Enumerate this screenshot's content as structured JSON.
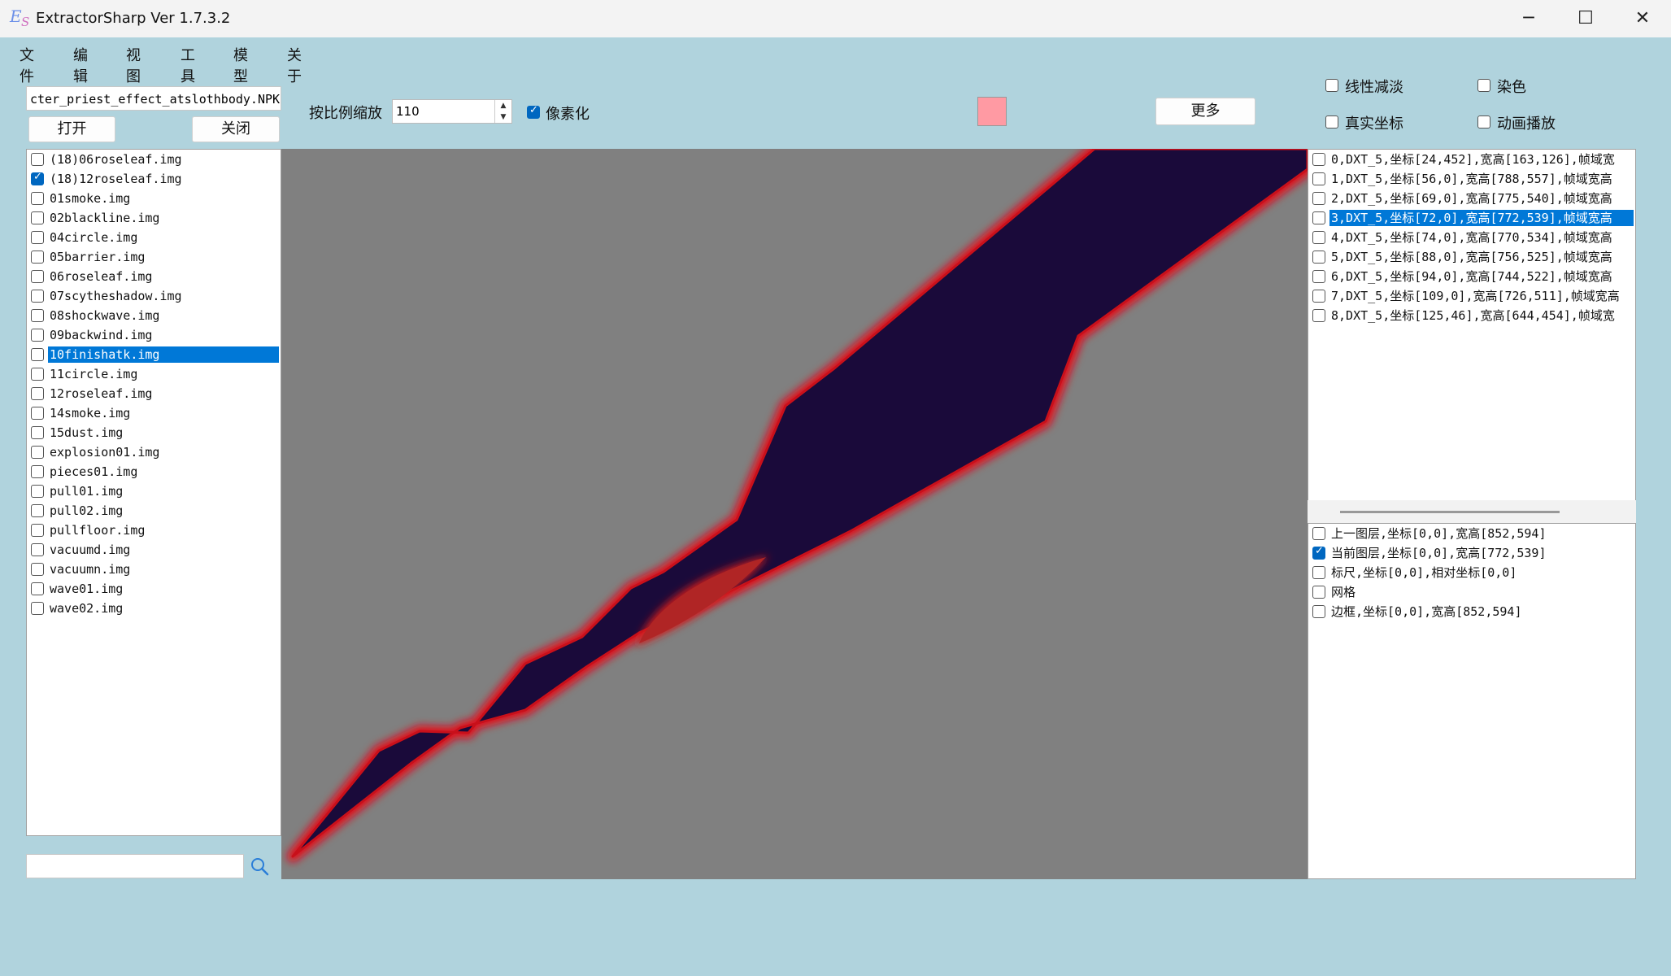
{
  "window": {
    "title": "ExtractorSharp Ver 1.7.3.2",
    "icon": "es-app-icon",
    "controls": {
      "minimize": "─",
      "maximize": "☐",
      "close": "✕"
    }
  },
  "menu": [
    "文件",
    "编辑",
    "视图",
    "工具",
    "模型",
    "关于"
  ],
  "toolbar": {
    "file_name": "cter_priest_effect_atslothbody.NPK",
    "open_label": "打开",
    "close_label": "关闭",
    "scale_label": "按比例缩放",
    "scale_value": "110",
    "pixelate_label": "像素化",
    "pixelate_checked": true,
    "color_swatch": "#ff9aa3",
    "more_label": "更多",
    "options": [
      {
        "label": "线性减淡",
        "checked": false
      },
      {
        "label": "染色",
        "checked": false
      },
      {
        "label": "真实坐标",
        "checked": false
      },
      {
        "label": "动画播放",
        "checked": false
      }
    ]
  },
  "file_list": [
    {
      "name": "(18)06roseleaf.img",
      "checked": false,
      "selected": false
    },
    {
      "name": "(18)12roseleaf.img",
      "checked": true,
      "selected": false
    },
    {
      "name": "01smoke.img",
      "checked": false,
      "selected": false
    },
    {
      "name": "02blackline.img",
      "checked": false,
      "selected": false
    },
    {
      "name": "04circle.img",
      "checked": false,
      "selected": false
    },
    {
      "name": "05barrier.img",
      "checked": false,
      "selected": false
    },
    {
      "name": "06roseleaf.img",
      "checked": false,
      "selected": false
    },
    {
      "name": "07scytheshadow.img",
      "checked": false,
      "selected": false
    },
    {
      "name": "08shockwave.img",
      "checked": false,
      "selected": false
    },
    {
      "name": "09backwind.img",
      "checked": false,
      "selected": false
    },
    {
      "name": "10finishatk.img",
      "checked": false,
      "selected": true
    },
    {
      "name": "11circle.img",
      "checked": false,
      "selected": false
    },
    {
      "name": "12roseleaf.img",
      "checked": false,
      "selected": false
    },
    {
      "name": "14smoke.img",
      "checked": false,
      "selected": false
    },
    {
      "name": "15dust.img",
      "checked": false,
      "selected": false
    },
    {
      "name": "explosion01.img",
      "checked": false,
      "selected": false
    },
    {
      "name": "pieces01.img",
      "checked": false,
      "selected": false
    },
    {
      "name": "pull01.img",
      "checked": false,
      "selected": false
    },
    {
      "name": "pull02.img",
      "checked": false,
      "selected": false
    },
    {
      "name": "pullfloor.img",
      "checked": false,
      "selected": false
    },
    {
      "name": "vacuumd.img",
      "checked": false,
      "selected": false
    },
    {
      "name": "vacuumn.img",
      "checked": false,
      "selected": false
    },
    {
      "name": "wave01.img",
      "checked": false,
      "selected": false
    },
    {
      "name": "wave02.img",
      "checked": false,
      "selected": false
    }
  ],
  "search": {
    "value": "",
    "icon": "search-icon"
  },
  "frame_list": [
    {
      "text": "0,DXT_5,坐标[24,452],宽高[163,126],帧域宽",
      "checked": false,
      "selected": false
    },
    {
      "text": "1,DXT_5,坐标[56,0],宽高[788,557],帧域宽高",
      "checked": false,
      "selected": false
    },
    {
      "text": "2,DXT_5,坐标[69,0],宽高[775,540],帧域宽高",
      "checked": false,
      "selected": false
    },
    {
      "text": "3,DXT_5,坐标[72,0],宽高[772,539],帧域宽高",
      "checked": false,
      "selected": true
    },
    {
      "text": "4,DXT_5,坐标[74,0],宽高[770,534],帧域宽高",
      "checked": false,
      "selected": false
    },
    {
      "text": "5,DXT_5,坐标[88,0],宽高[756,525],帧域宽高",
      "checked": false,
      "selected": false
    },
    {
      "text": "6,DXT_5,坐标[94,0],宽高[744,522],帧域宽高",
      "checked": false,
      "selected": false
    },
    {
      "text": "7,DXT_5,坐标[109,0],宽高[726,511],帧域宽高",
      "checked": false,
      "selected": false
    },
    {
      "text": "8,DXT_5,坐标[125,46],宽高[644,454],帧域宽",
      "checked": false,
      "selected": false
    }
  ],
  "layer_list": [
    {
      "text": "上一图层,坐标[0,0],宽高[852,594]",
      "checked": false
    },
    {
      "text": "当前图层,坐标[0,0],宽高[772,539]",
      "checked": true
    },
    {
      "text": "标尺,坐标[0,0],相对坐标[0,0]",
      "checked": false
    },
    {
      "text": "网格",
      "checked": false
    },
    {
      "text": "边框,坐标[0,0],宽高[852,594]",
      "checked": false
    }
  ],
  "colors": {
    "window_bg": "#b0d3dd",
    "canvas_bg": "#808080",
    "selection": "#0078d7",
    "sprite_fill": "#1a0a3a",
    "sprite_glow": "#e0101a"
  }
}
